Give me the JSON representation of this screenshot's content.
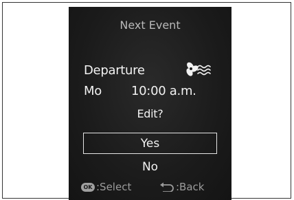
{
  "screen": {
    "title": "Next Event",
    "event": {
      "name": "Departure",
      "icon": "fan-icon",
      "day": "Mo",
      "time": "10:00 a.m."
    },
    "prompt": "Edit?",
    "options": [
      {
        "label": "Yes",
        "selected": true
      },
      {
        "label": "No",
        "selected": false
      }
    ],
    "hints": {
      "select_key": "OK",
      "select_label": ":Select",
      "back_icon": "back-arrow-icon",
      "back_label": ":Back"
    }
  }
}
